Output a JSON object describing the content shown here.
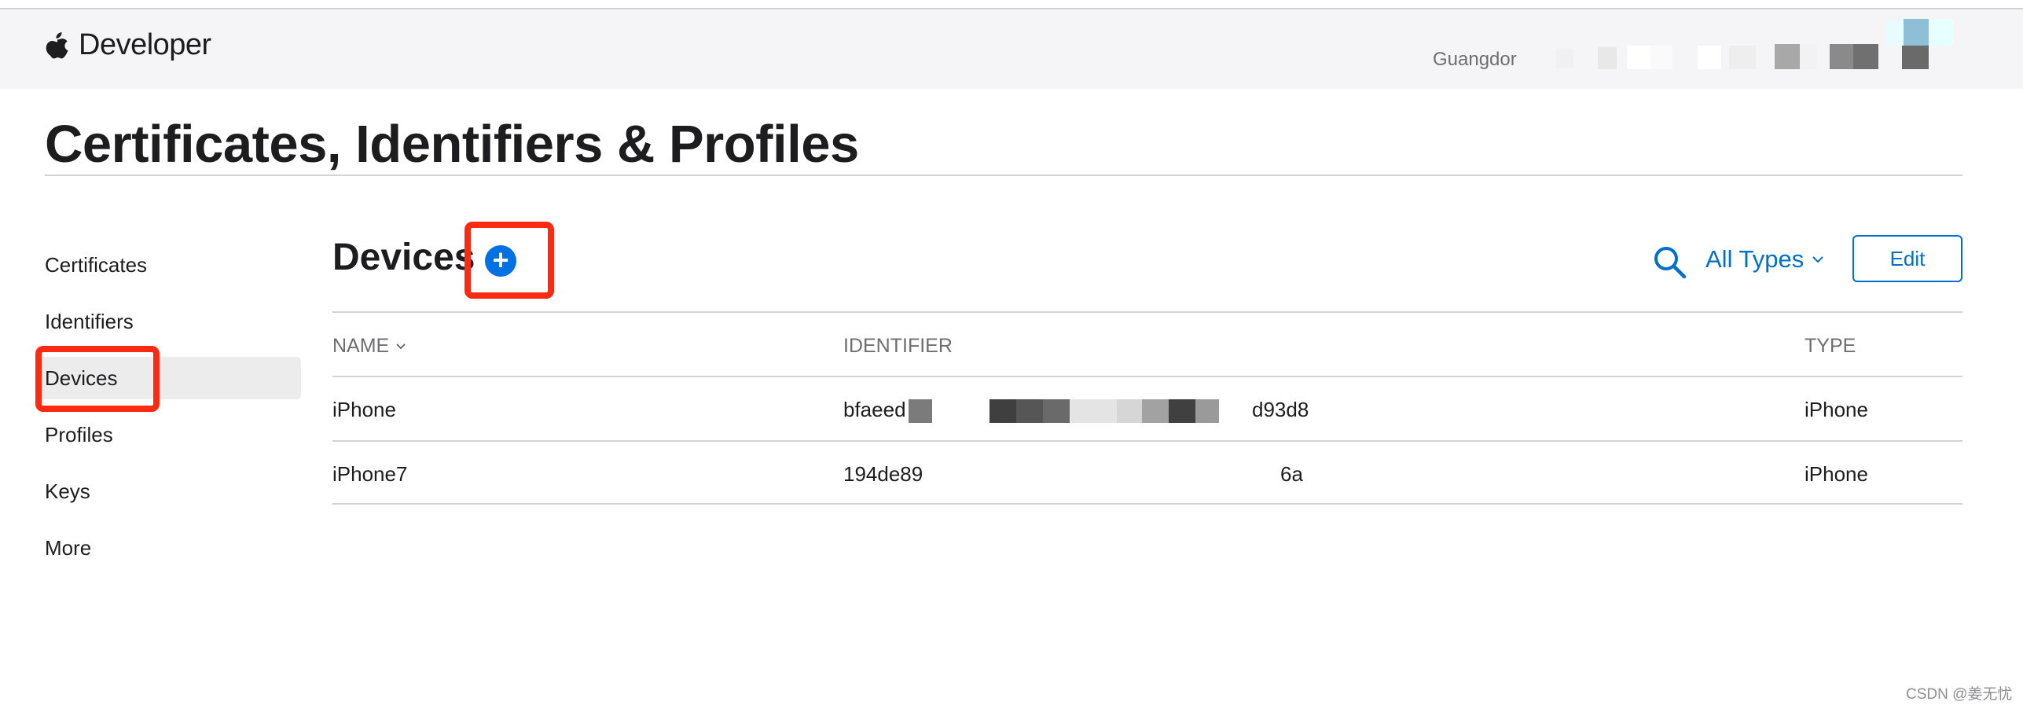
{
  "header": {
    "brand": "Developer",
    "account_name": "Guangdor"
  },
  "page_title": "Certificates, Identifiers & Profiles",
  "sidebar": {
    "items": [
      {
        "label": "Certificates"
      },
      {
        "label": "Identifiers"
      },
      {
        "label": "Devices",
        "active": true
      },
      {
        "label": "Profiles"
      },
      {
        "label": "Keys"
      },
      {
        "label": "More"
      }
    ]
  },
  "devices": {
    "section_title": "Devices",
    "add_symbol": "+",
    "filter_label": "All Types",
    "edit_label": "Edit",
    "columns": {
      "name": "NAME",
      "identifier": "IDENTIFIER",
      "type": "TYPE"
    },
    "rows": [
      {
        "name": "iPhone",
        "identifier_start": "bfaeed",
        "identifier_end": "d93d8",
        "type": "iPhone"
      },
      {
        "name": "iPhone7",
        "identifier_start": "194de89",
        "identifier_end": "6a",
        "type": "iPhone"
      }
    ]
  },
  "colors": {
    "accent": "#0071e3",
    "link": "#0070c9",
    "highlight": "#fa2b12"
  },
  "watermark": "CSDN @姜无忧"
}
